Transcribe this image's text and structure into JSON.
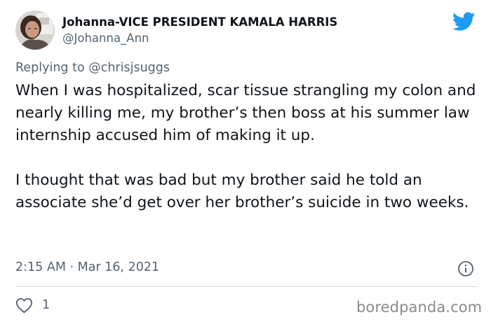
{
  "tweet": {
    "author": {
      "display_name": "Johanna-VICE PRESIDENT KAMALA HARRIS",
      "handle": "@Johanna_Ann"
    },
    "reply_context": "Replying to @chrisjsuggs",
    "paragraphs": [
      "When I was hospitalized, scar tissue strangling my colon and nearly killing me, my brother’s then boss at his summer law internship accused him of making it up.",
      "I thought that was bad but my brother said he told an associate she’d get over her brother’s suicide in two weeks."
    ],
    "timestamp": "2:15 AM · Mar 16, 2021",
    "likes": "1"
  },
  "icons": {
    "logo": "twitter-bird-icon",
    "info": "info-icon",
    "like": "heart-icon"
  },
  "watermark": "boredpanda.com",
  "colors": {
    "twitter_blue": "#1d9bf0",
    "secondary_text": "#536471",
    "primary_text": "#0f1419"
  }
}
